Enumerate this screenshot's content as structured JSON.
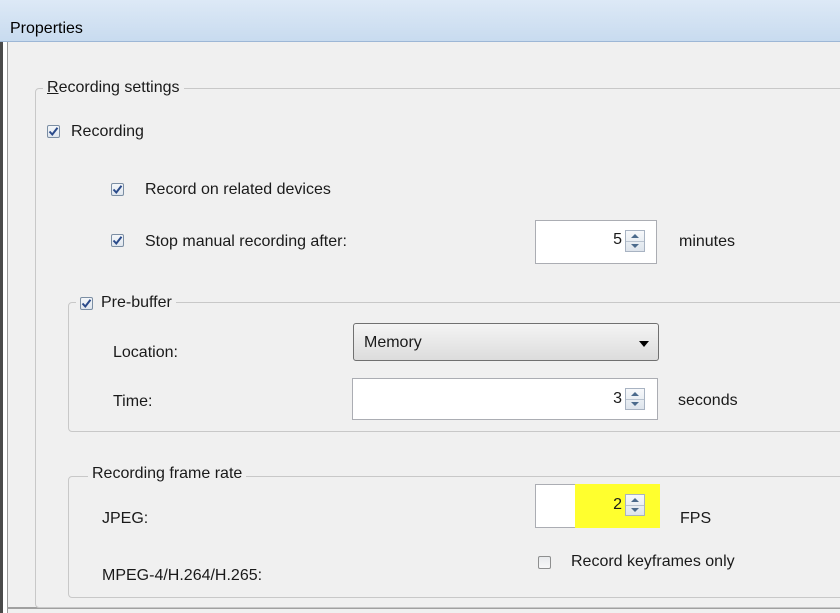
{
  "window": {
    "title": "Properties"
  },
  "recording_settings": {
    "legend_accel": "R",
    "legend_rest": "ecording settings",
    "recording": {
      "label": "Recording",
      "checked": true
    },
    "record_related": {
      "label": "Record on related devices",
      "checked": true
    },
    "stop_manual": {
      "label": "Stop manual recording after:",
      "checked": true,
      "value": "5",
      "unit": "minutes"
    }
  },
  "pre_buffer": {
    "label": "Pre-buffer",
    "checked": true,
    "location_label": "Location:",
    "location_value": "Memory",
    "time_label": "Time:",
    "time_value": "3",
    "time_unit": "seconds"
  },
  "frame_rate": {
    "legend": "Recording frame rate",
    "jpeg_label": "JPEG:",
    "jpeg_value": "2",
    "jpeg_unit": "FPS",
    "jpeg_highlight_color": "#ffff2e",
    "mpeg_label": "MPEG-4/H.264/H.265:",
    "keyframes": {
      "label": "Record keyframes only",
      "checked": false
    }
  }
}
